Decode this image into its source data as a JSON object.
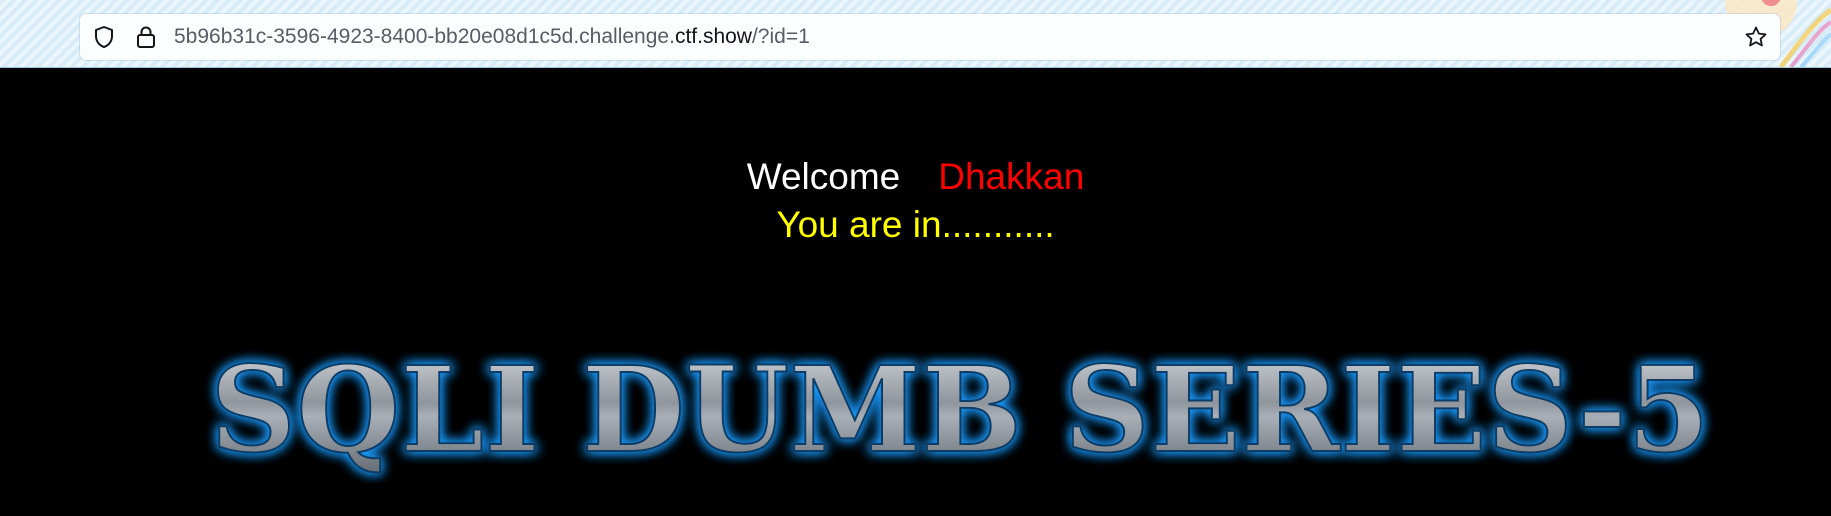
{
  "browser": {
    "url_prefix": "5b96b31c-3596-4923-8400-bb20e08d1c5d.challenge.",
    "url_host": "ctf.show",
    "url_suffix": "/?id=1",
    "icons": {
      "tracking": "shield-icon",
      "security": "lock-icon",
      "bookmark": "star-icon"
    }
  },
  "page": {
    "welcome_word": "Welcome",
    "welcome_name": "Dhakkan",
    "status": "You are in...........",
    "banner_text": "SQLI DUMB SERIES-5",
    "colors": {
      "background": "#000000",
      "welcome": "#ffffff",
      "name": "#ff0000",
      "status": "#ffff00",
      "banner_glow": "#1e9bff"
    }
  }
}
